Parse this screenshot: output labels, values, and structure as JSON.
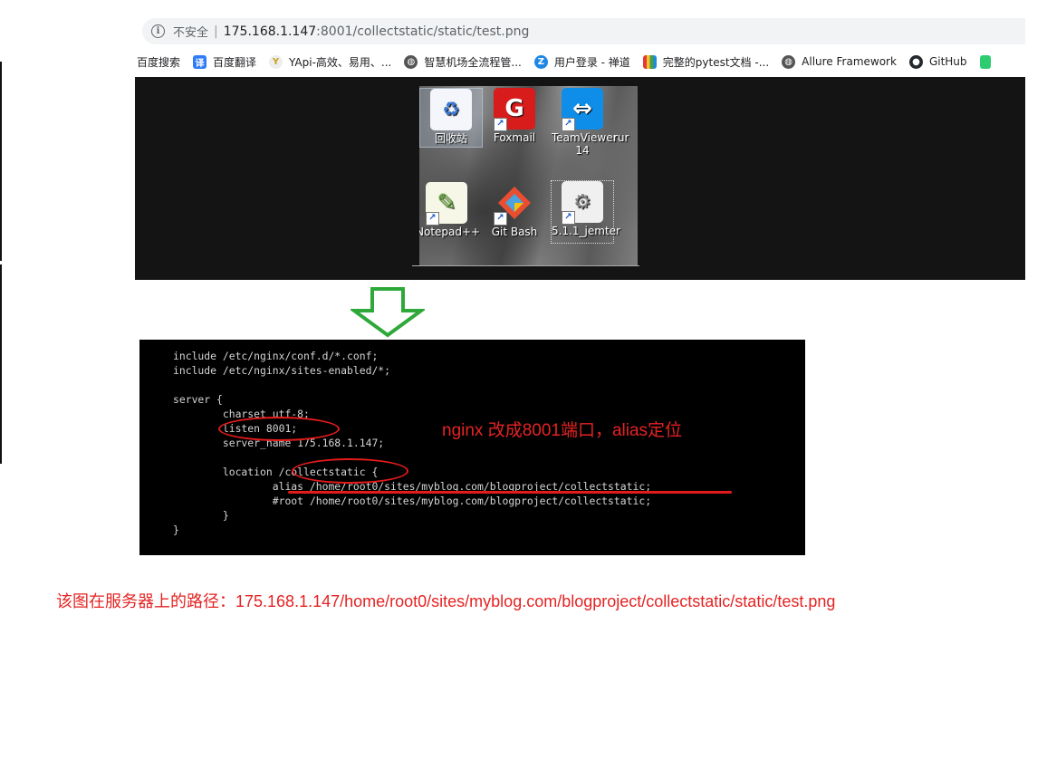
{
  "browser": {
    "insecure_label": "不安全",
    "url_host": "175.168.1.147",
    "url_path": ":8001/collectstatic/static/test.png"
  },
  "bookmarks": [
    {
      "label": "百度搜索",
      "icon": "none"
    },
    {
      "label": "百度翻译",
      "icon": "baidu-translate-icon",
      "color": "#2f7cf6"
    },
    {
      "label": "YApi-高效、易用、...",
      "icon": "yapi-icon",
      "color": "#e6e6e6"
    },
    {
      "label": "智慧机场全流程管...",
      "icon": "globe-icon",
      "color": "#555555"
    },
    {
      "label": "用户登录 - 禅道",
      "icon": "zentao-icon",
      "color": "#1e88e5"
    },
    {
      "label": "完整的pytest文档 -...",
      "icon": "bars-icon",
      "color": "#e53935"
    },
    {
      "label": "Allure Framework",
      "icon": "globe-icon",
      "color": "#555555"
    },
    {
      "label": "GitHub",
      "icon": "github-icon",
      "color": "#24292e"
    }
  ],
  "desktop_icons": [
    {
      "label": "回收站",
      "icon": "recycle-bin-icon"
    },
    {
      "label": "Foxmail",
      "icon": "foxmail-icon"
    },
    {
      "label": "TeamViewer\n14",
      "icon": "teamviewer-icon"
    },
    {
      "label": "rur",
      "icon": "partial-icon"
    },
    {
      "label": "Notepad++",
      "icon": "notepad-plus-plus-icon"
    },
    {
      "label": "Git Bash",
      "icon": "git-bash-icon"
    },
    {
      "label": "5.1.1_jemter",
      "icon": "jmeter-shortcut-icon"
    }
  ],
  "terminal_lines": [
    "include /etc/nginx/conf.d/*.conf;",
    "include /etc/nginx/sites-enabled/*;",
    "",
    "server {",
    "        charset utf-8;",
    "        listen 8001;",
    "        server_name 175.168.1.147;",
    "",
    "        location /collectstatic {",
    "                alias /home/root0/sites/myblog.com/blogproject/collectstatic;",
    "                #root /home/root0/sites/myblog.com/blogproject/collectstatic;",
    "        }",
    "}"
  ],
  "annotation": "nginx 改成8001端口，alias定位",
  "caption": "该图在服务器上的路径：175.168.1.147/home/root0/sites/myblog.com/blogproject/collectstatic/static/test.png",
  "colors": {
    "annotation_red": "#e52323",
    "arrow_green": "#2fa83a"
  }
}
